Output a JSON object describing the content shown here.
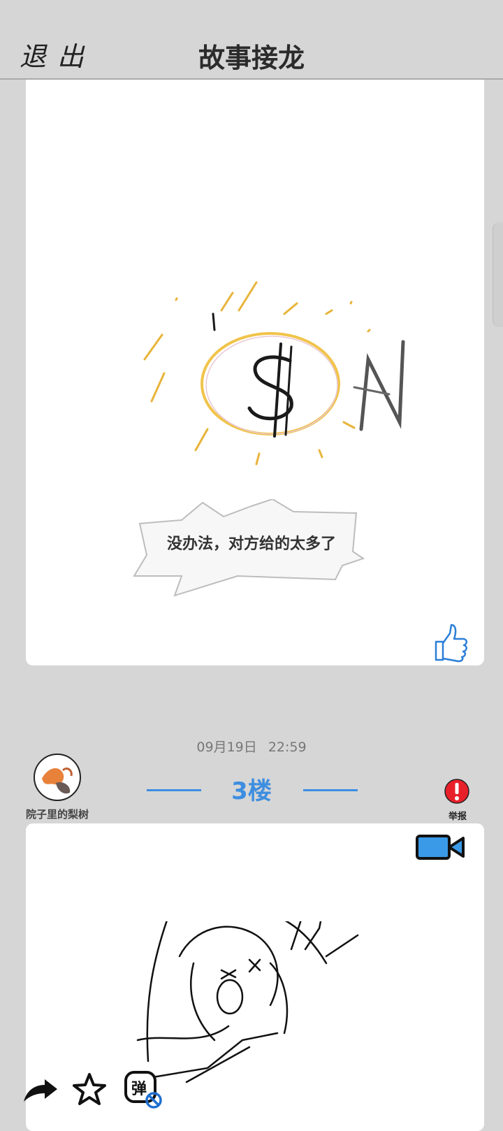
{
  "header": {
    "exit_label": "退出",
    "title": "故事接龙"
  },
  "post1": {
    "drawing_text": "$N",
    "caption": "没办法，对方给的太多了",
    "like_icon": "thumbs-up-icon"
  },
  "post2": {
    "timestamp": "09月19日  22:59",
    "username": "院子里的梨树",
    "floor": "3楼",
    "report_label": "举报",
    "video_icon": "video-camera-icon"
  },
  "toolbar": {
    "share_icon": "share-arrow-icon",
    "favorite_icon": "star-icon",
    "danmaku_icon": "danmaku-icon",
    "danmaku_glyph": "弹"
  },
  "colors": {
    "accent": "#3d8ee0",
    "background": "#d6d6d6",
    "report_red": "#e8202a",
    "video_blue": "#3a9ae8"
  }
}
